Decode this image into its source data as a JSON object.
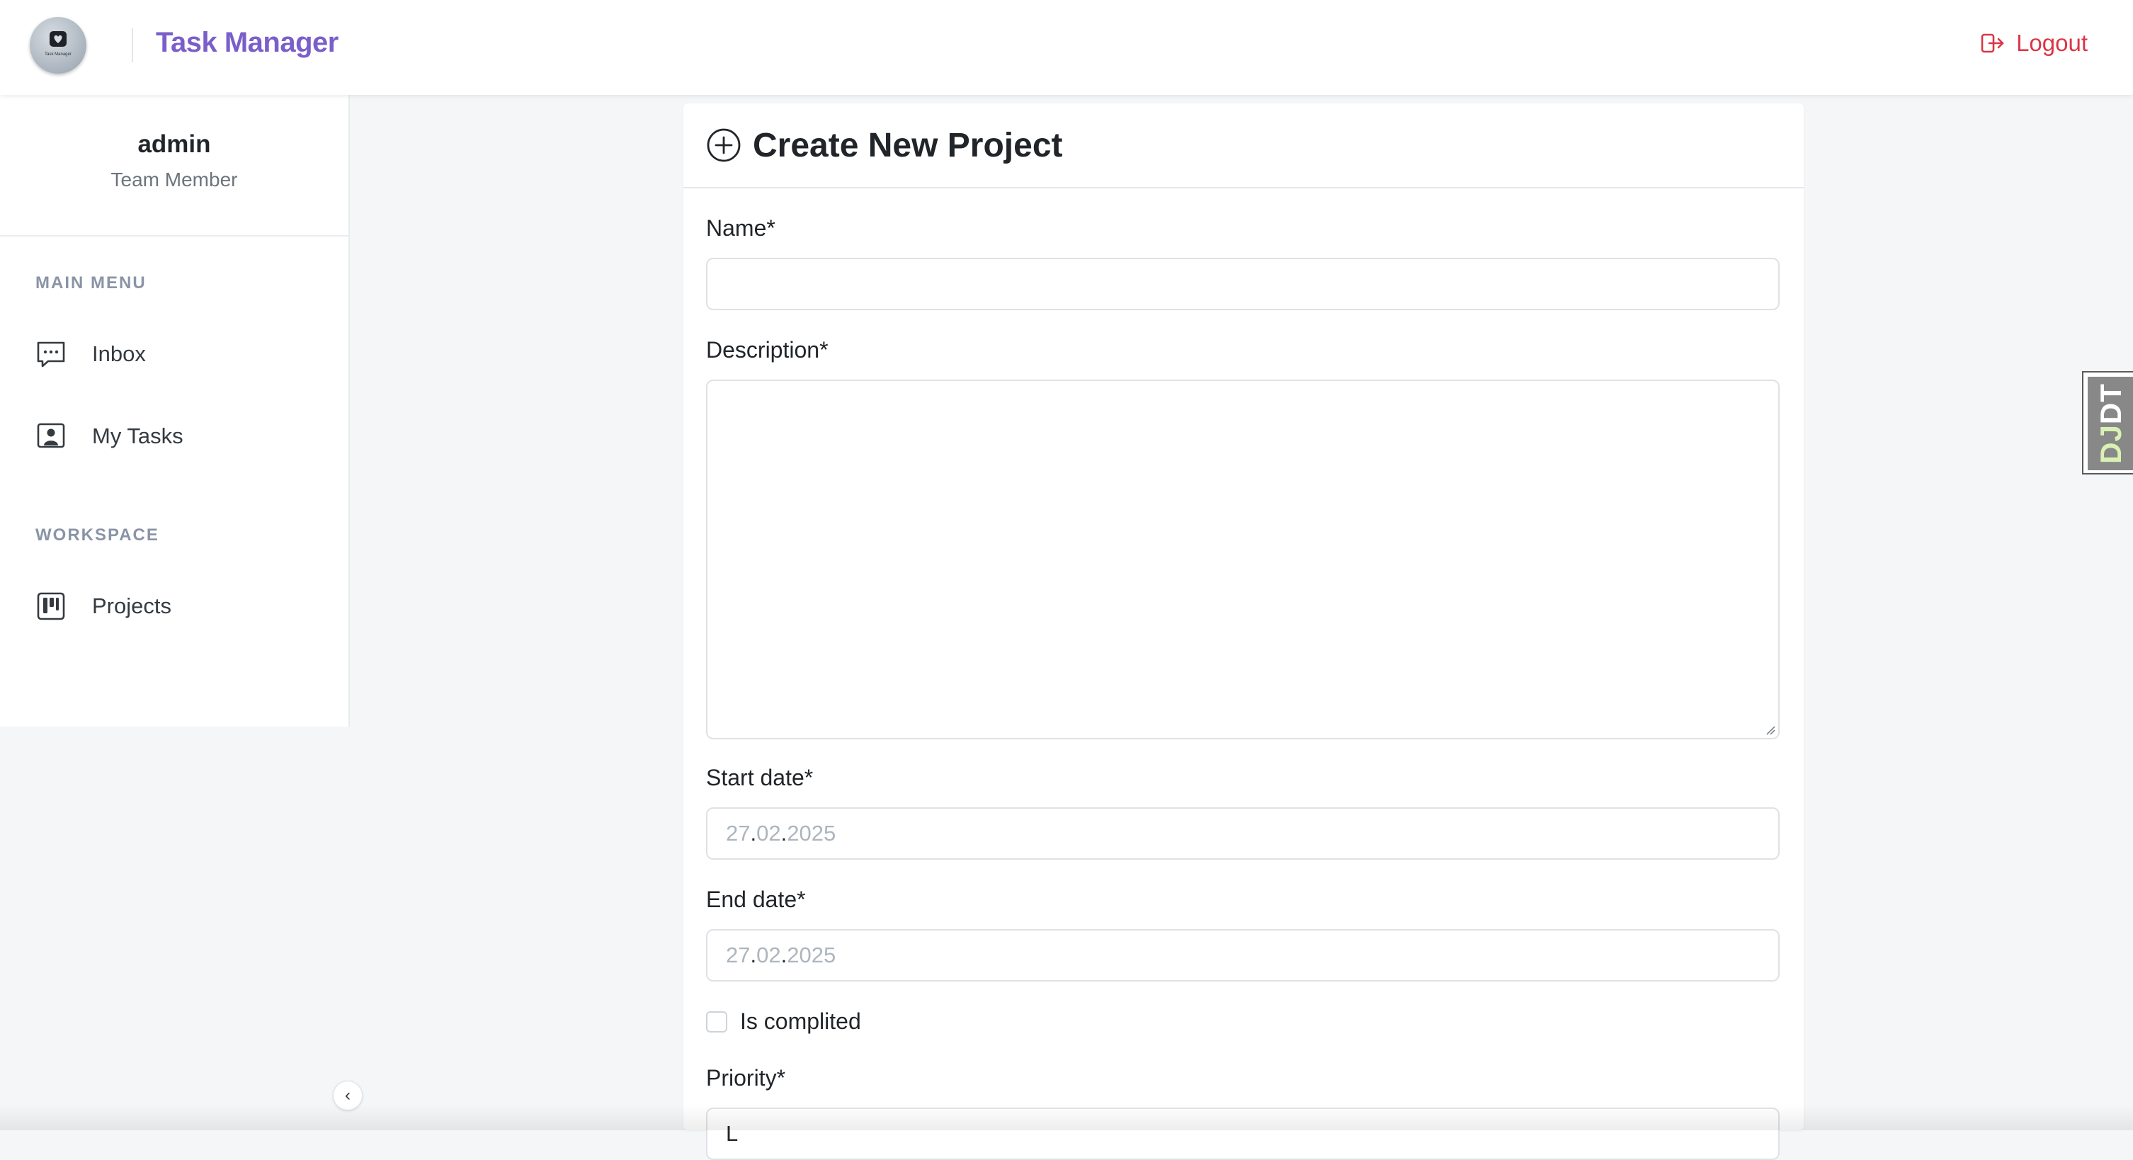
{
  "header": {
    "brand": "Task Manager",
    "logo_caption": "Task Manager",
    "logout_label": "Logout"
  },
  "user": {
    "name": "admin",
    "role": "Team Member"
  },
  "sidebar": {
    "main_menu_title": "MAIN MENU",
    "main_items": [
      {
        "label": "Inbox",
        "icon": "chat-icon"
      },
      {
        "label": "My Tasks",
        "icon": "person-board-icon"
      }
    ],
    "workspace_title": "WORKSPACE",
    "workspace_items": [
      {
        "label": "Projects",
        "icon": "kanban-icon"
      }
    ],
    "collapse_glyph": "‹"
  },
  "form": {
    "title": "Create New Project",
    "name_label": "Name*",
    "name_value": "",
    "description_label": "Description*",
    "description_value": "",
    "start_date_label": "Start date*",
    "start_date_placeholder": {
      "day": "27",
      "month": "02",
      "year": "2025"
    },
    "end_date_label": "End date*",
    "end_date_placeholder": {
      "day": "27",
      "month": "02",
      "year": "2025"
    },
    "completed_label": "Is complited",
    "completed_checked": false,
    "priority_label": "Priority*",
    "priority_value": "L"
  },
  "debug_toolbar": {
    "label_dj": "DJ",
    "label_dt": "DT"
  },
  "colors": {
    "brand": "#7a5ec9",
    "logout": "#dc3545",
    "background": "#f4f6f8"
  }
}
